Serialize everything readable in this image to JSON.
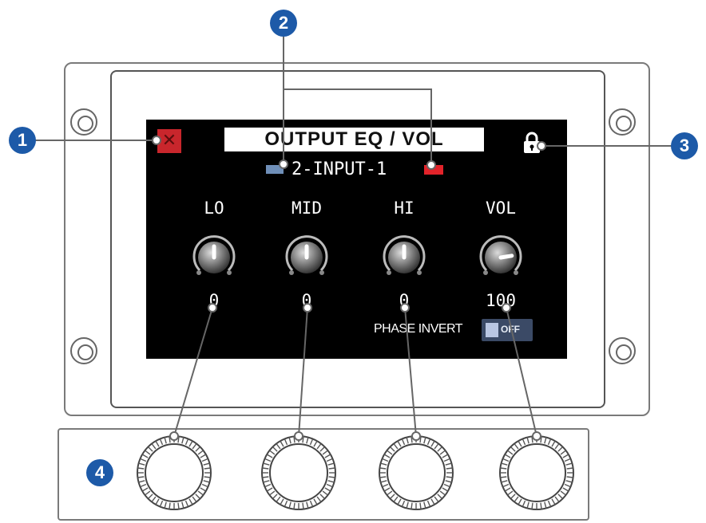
{
  "screen": {
    "title": "OUTPUT EQ / VOL",
    "close_icon": "close-icon",
    "lock_icon": "lock-icon",
    "input_name": "2-INPUT-1",
    "input_colors": {
      "left": "#6f8fb8",
      "right": "#e2232a"
    },
    "knobs": [
      {
        "label": "LO",
        "value": "0",
        "level": 0.5
      },
      {
        "label": "MID",
        "value": "0",
        "level": 0.5
      },
      {
        "label": "HI",
        "value": "0",
        "level": 0.5
      },
      {
        "label": "VOL",
        "value": "100",
        "level": 0.8
      }
    ],
    "phase_invert": {
      "label": "PHASE INVERT",
      "state": "OFF"
    }
  },
  "callouts": [
    "1",
    "2",
    "3",
    "4"
  ],
  "colors": {
    "callout": "#1d5aa8",
    "close": "#c8262c",
    "toggle": "#3b4a66"
  }
}
